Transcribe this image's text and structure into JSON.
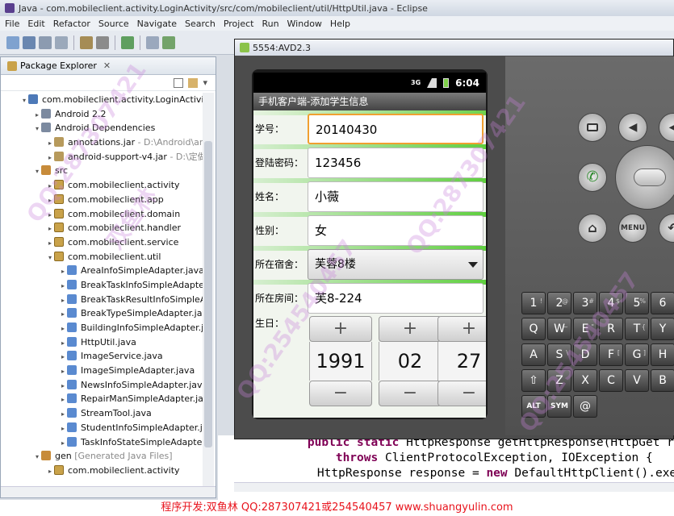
{
  "window": {
    "title": "Java - com.mobileclient.activity.LoginActivity/src/com/mobileclient/util/HttpUtil.java - Eclipse"
  },
  "menu": [
    "File",
    "Edit",
    "Refactor",
    "Source",
    "Navigate",
    "Search",
    "Project",
    "Run",
    "Window",
    "Help"
  ],
  "package_explorer": {
    "tab_label": "Package Explorer",
    "tree": [
      {
        "indent": 1,
        "twisty": "▾",
        "icon": "project",
        "label": "com.mobileclient.activity.LoginActivity",
        "deco": ""
      },
      {
        "indent": 2,
        "twisty": "▸",
        "icon": "lib",
        "label": "Android 2.2",
        "deco": ""
      },
      {
        "indent": 2,
        "twisty": "▾",
        "icon": "lib",
        "label": "Android Dependencies",
        "deco": ""
      },
      {
        "indent": 3,
        "twisty": "▸",
        "icon": "jar",
        "label": "annotations.jar",
        "deco": " - D:\\Android\\anc"
      },
      {
        "indent": 3,
        "twisty": "▸",
        "icon": "jar",
        "label": "android-support-v4.jar",
        "deco": " - D:\\定做"
      },
      {
        "indent": 2,
        "twisty": "▾",
        "icon": "src",
        "label": "src",
        "deco": ""
      },
      {
        "indent": 3,
        "twisty": "▸",
        "icon": "pkg",
        "label": "com.mobileclient.activity",
        "deco": ""
      },
      {
        "indent": 3,
        "twisty": "▸",
        "icon": "pkg",
        "label": "com.mobileclient.app",
        "deco": ""
      },
      {
        "indent": 3,
        "twisty": "▸",
        "icon": "pkg",
        "label": "com.mobileclient.domain",
        "deco": ""
      },
      {
        "indent": 3,
        "twisty": "▸",
        "icon": "pkg",
        "label": "com.mobileclient.handler",
        "deco": ""
      },
      {
        "indent": 3,
        "twisty": "▸",
        "icon": "pkg",
        "label": "com.mobileclient.service",
        "deco": ""
      },
      {
        "indent": 3,
        "twisty": "▾",
        "icon": "pkg",
        "label": "com.mobileclient.util",
        "deco": ""
      },
      {
        "indent": 4,
        "twisty": "▸",
        "icon": "java",
        "label": "AreaInfoSimpleAdapter.java",
        "deco": ""
      },
      {
        "indent": 4,
        "twisty": "▸",
        "icon": "java",
        "label": "BreakTaskInfoSimpleAdapter",
        "deco": ""
      },
      {
        "indent": 4,
        "twisty": "▸",
        "icon": "java",
        "label": "BreakTaskResultInfoSimpleA",
        "deco": ""
      },
      {
        "indent": 4,
        "twisty": "▸",
        "icon": "java",
        "label": "BreakTypeSimpleAdapter.jav",
        "deco": ""
      },
      {
        "indent": 4,
        "twisty": "▸",
        "icon": "java",
        "label": "BuildingInfoSimpleAdapter.ja",
        "deco": ""
      },
      {
        "indent": 4,
        "twisty": "▸",
        "icon": "java",
        "label": "HttpUtil.java",
        "deco": ""
      },
      {
        "indent": 4,
        "twisty": "▸",
        "icon": "java",
        "label": "ImageService.java",
        "deco": ""
      },
      {
        "indent": 4,
        "twisty": "▸",
        "icon": "java",
        "label": "ImageSimpleAdapter.java",
        "deco": ""
      },
      {
        "indent": 4,
        "twisty": "▸",
        "icon": "java",
        "label": "NewsInfoSimpleAdapter.java",
        "deco": ""
      },
      {
        "indent": 4,
        "twisty": "▸",
        "icon": "java",
        "label": "RepairManSimpleAdapter.jav",
        "deco": ""
      },
      {
        "indent": 4,
        "twisty": "▸",
        "icon": "java",
        "label": "StreamTool.java",
        "deco": ""
      },
      {
        "indent": 4,
        "twisty": "▸",
        "icon": "java",
        "label": "StudentInfoSimpleAdapter.ja",
        "deco": ""
      },
      {
        "indent": 4,
        "twisty": "▸",
        "icon": "java",
        "label": "TaskInfoStateSimpleAdapter.",
        "deco": ""
      },
      {
        "indent": 2,
        "twisty": "▾",
        "icon": "src",
        "label": "gen",
        "deco": " [Generated Java Files]"
      },
      {
        "indent": 3,
        "twisty": "▸",
        "icon": "pkg",
        "label": "com.mobileclient.activity",
        "deco": ""
      }
    ]
  },
  "editor": {
    "lines": [
      [
        {
          "t": "    "
        },
        {
          "t": "public static",
          "kw": true
        },
        {
          "t": " HttpResponse getHttpResponse(HttpGet reque"
        }
      ],
      [
        {
          "t": "        "
        },
        {
          "t": "throws",
          "kw": true
        },
        {
          "t": " ClientProtocolException, IOException {"
        }
      ],
      [
        {
          "t": "    HttpResponse response = "
        },
        {
          "t": "new",
          "kw": true
        },
        {
          "t": " DefaultHttpClient().exec"
        }
      ]
    ]
  },
  "emulator": {
    "title": "5554:AVD2.3",
    "status_time": "6:04",
    "status_3g": "3G",
    "app_title": "手机客户端-添加学生信息",
    "fields": {
      "student_no": {
        "label": "学号：",
        "value": "20140430"
      },
      "password": {
        "label": "登陆密码：",
        "value": "123456"
      },
      "name": {
        "label": "姓名：",
        "value": "小薇"
      },
      "gender": {
        "label": "性别：",
        "value": "女"
      },
      "dorm": {
        "label": "所在宿舍：",
        "value": "芙蓉8楼"
      },
      "room": {
        "label": "所在房间：",
        "value": "芙8-224"
      },
      "birthday": {
        "label": "生日：",
        "year": "1991",
        "month": "02",
        "day": "27"
      }
    },
    "hw_buttons": {
      "menu": "MENU"
    },
    "keyboard": [
      {
        "k": "1",
        "s": "!"
      },
      {
        "k": "2",
        "s": "@"
      },
      {
        "k": "3",
        "s": "#"
      },
      {
        "k": "4",
        "s": "$"
      },
      {
        "k": "5",
        "s": "%"
      },
      {
        "k": "6",
        "s": ""
      },
      {
        "k": "Q",
        "s": ""
      },
      {
        "k": "W",
        "s": "~"
      },
      {
        "k": "E",
        "s": "\""
      },
      {
        "k": "R",
        "s": ""
      },
      {
        "k": "T",
        "s": "{"
      },
      {
        "k": "Y",
        "s": ""
      },
      {
        "k": "A",
        "s": ""
      },
      {
        "k": "S",
        "s": "\\"
      },
      {
        "k": "D",
        "s": ""
      },
      {
        "k": "F",
        "s": "["
      },
      {
        "k": "G",
        "s": "]"
      },
      {
        "k": "H",
        "s": ""
      },
      {
        "k": "⇧",
        "s": ""
      },
      {
        "k": "Z",
        "s": ""
      },
      {
        "k": "X",
        "s": ""
      },
      {
        "k": "C",
        "s": ""
      },
      {
        "k": "V",
        "s": ""
      },
      {
        "k": "B",
        "s": ""
      },
      {
        "k": "ALT",
        "s": ""
      },
      {
        "k": "SYM",
        "s": ""
      },
      {
        "k": "@",
        "s": ""
      }
    ]
  },
  "footer": "程序开发:双鱼林 QQ:287307421或254540457 www.shuangyulin.com",
  "watermarks": [
    "QQ:287307421",
    "双鱼林",
    "QQ:254540457"
  ],
  "colors": {
    "footer_text": "#e8131c",
    "keyword": "#7f0055",
    "focus": "#f0a030"
  }
}
